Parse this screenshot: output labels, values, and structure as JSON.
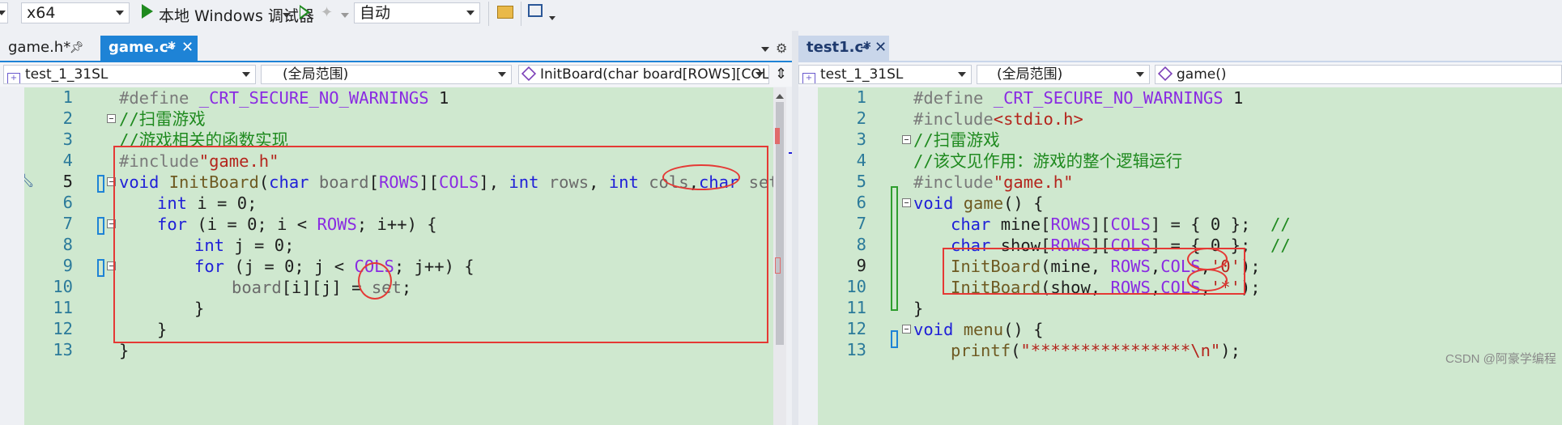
{
  "toolbar": {
    "platform": "x64",
    "debugger_label": "本地 Windows 调试器",
    "config": "自动"
  },
  "left": {
    "tabs": [
      {
        "label": "game.h*"
      },
      {
        "label": "game.c*"
      }
    ],
    "nav": {
      "project": "test_1_31SL",
      "scope": "(全局范围)",
      "member": "InitBoard(char board[ROWS][COLS], int"
    },
    "line_numbers": [
      "1",
      "2",
      "3",
      "4",
      "5",
      "6",
      "7",
      "8",
      "9",
      "10",
      "11",
      "12",
      "13"
    ]
  },
  "right": {
    "tabs": [
      {
        "label": "test1.c*"
      }
    ],
    "nav": {
      "project": "test_1_31SL",
      "scope": "(全局范围)",
      "member": "game()"
    },
    "line_numbers": [
      "1",
      "2",
      "3",
      "4",
      "5",
      "6",
      "7",
      "8",
      "9",
      "10",
      "11",
      "12",
      "13"
    ]
  },
  "watermark": "CSDN @阿豪学编程",
  "colors": {
    "editor_bg": "#cfe8cf",
    "active_tab": "#1e83d6",
    "annotation": "#e53935"
  },
  "code": {
    "left": {
      "l1a": "#define ",
      "l1b": "_CRT_SECURE_NO_WARNINGS",
      "l1c": " 1",
      "l2": "//扫雷游戏",
      "l3": "//游戏相关的函数实现",
      "l4a": "#include",
      "l4b": "\"game.h\"",
      "l5a": "void",
      "l5b": " ",
      "l5c": "InitBoard",
      "l5d": "(",
      "l5e": "char",
      "l5f": " ",
      "l5g": "board",
      "l5h": "[",
      "l5i": "ROWS",
      "l5j": "][",
      "l5k": "COLS",
      "l5l": "], ",
      "l5m": "int",
      "l5n": " ",
      "l5o": "rows",
      "l5p": ", ",
      "l5q": "int",
      "l5r": " ",
      "l5s": "cols",
      "l5t": ",",
      "l5u": "char",
      "l5v": " ",
      "l5w": "set",
      "l5x": ") {",
      "l6a": "int",
      "l6b": " i = 0;",
      "l7a": "for",
      "l7b": " (i = 0; i < ",
      "l7c": "ROWS",
      "l7d": "; i++) {",
      "l8a": "int",
      "l8b": " j = 0;",
      "l9a": "for",
      "l9b": " (j = 0; j < ",
      "l9c": "COLS",
      "l9d": "; j++) {",
      "l10a": "board",
      "l10b": "[i][j] = ",
      "l10c": "set",
      "l10d": ";",
      "l11": "}",
      "l12": "}",
      "l13": "}"
    },
    "right": {
      "l1a": "#define ",
      "l1b": "_CRT_SECURE_NO_WARNINGS",
      "l1c": " 1",
      "l2a": "#include",
      "l2b": "<stdio.h>",
      "l3": "//扫雷游戏",
      "l4": "//该文见作用：游戏的整个逻辑运行",
      "l5a": "#include",
      "l5b": "\"game.h\"",
      "l6a": "void",
      "l6b": " ",
      "l6c": "game",
      "l6d": "() {",
      "l7a": "char",
      "l7b": " mine[",
      "l7c": "ROWS",
      "l7d": "][",
      "l7e": "COLS",
      "l7f": "] = { 0 };  ",
      "l7g": "//",
      "l8a": "char",
      "l8b": " show[",
      "l8c": "ROWS",
      "l8d": "][",
      "l8e": "COLS",
      "l8f": "] = { 0 };  ",
      "l8g": "//",
      "l9a": "InitBoard",
      "l9b": "(mine, ",
      "l9c": "ROWS",
      "l9d": ",",
      "l9e": "COLS",
      "l9f": ",",
      "l9g": "'0'",
      "l9h": ");",
      "l10a": "InitBoard",
      "l10b": "(show, ",
      "l10c": "ROWS",
      "l10d": ",",
      "l10e": "COLS",
      "l10f": ",",
      "l10g": "'*'",
      "l10h": ");",
      "l11": "}",
      "l12a": "void",
      "l12b": " ",
      "l12c": "menu",
      "l12d": "() {",
      "l13a": "printf",
      "l13b": "(",
      "l13c": "\"****************\\n\"",
      "l13d": ");"
    }
  }
}
